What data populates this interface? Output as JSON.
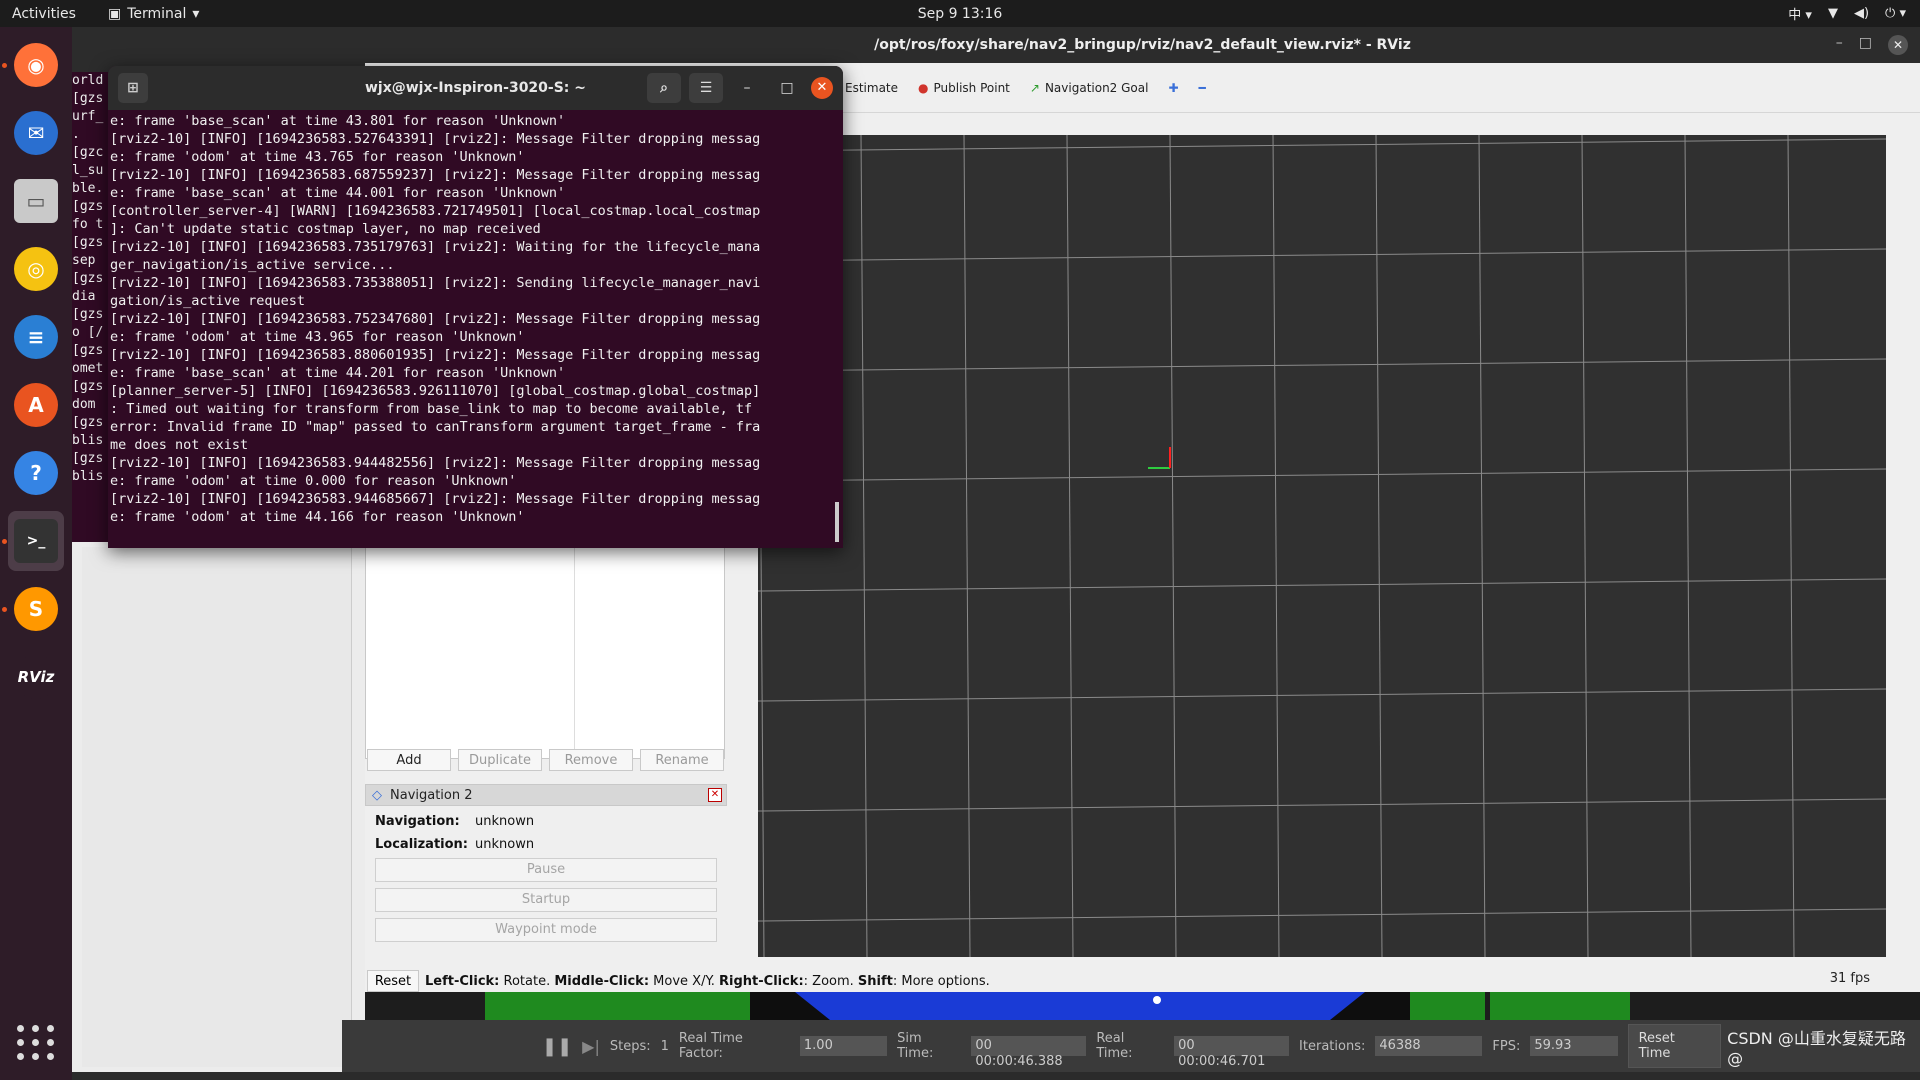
{
  "topbar": {
    "activities": "Activities",
    "app_name": "Terminal",
    "clock": "Sep 9  13:16",
    "input_method": "中"
  },
  "dock": {
    "items": [
      {
        "name": "firefox-icon",
        "color": "#ff7139"
      },
      {
        "name": "thunderbird-icon",
        "color": "#2a6fd0"
      },
      {
        "name": "files-icon",
        "color": "#c9c9c9"
      },
      {
        "name": "rhythmbox-icon",
        "color": "#f5c211"
      },
      {
        "name": "writer-icon",
        "color": "#2a7fd4"
      },
      {
        "name": "software-center-icon",
        "color": "#e95420"
      },
      {
        "name": "help-icon",
        "color": "#3584e4"
      },
      {
        "name": "terminal-icon",
        "color": "#333333"
      },
      {
        "name": "sublime-icon",
        "color": "#ff9800"
      },
      {
        "name": "rviz-icon",
        "color": "#2e1c28"
      }
    ]
  },
  "bg_terminal": {
    "lines": [
      "orld",
      "[gzs",
      "urf_",
      ".",
      "[gzc",
      "l_su",
      "ble.",
      "[gzs",
      "fo t",
      "[gzs",
      " sep",
      "[gzs",
      " dia",
      "[gzs",
      "o [/",
      "[gzs",
      "omet",
      "[gzs",
      "dom ",
      "[gzs",
      "blis",
      "[gzs",
      "blis"
    ]
  },
  "rviz": {
    "title": "/opt/ros/foxy/share/nav2_bringup/rviz/nav2_default_view.rviz* - RViz",
    "toolbar": {
      "estimate": "Estimate",
      "publish_point": "Publish Point",
      "nav2_goal": "Navigation2 Goal"
    },
    "displays_buttons": {
      "add": "Add",
      "duplicate": "Duplicate",
      "remove": "Remove",
      "rename": "Rename"
    },
    "nav_panel": {
      "title": "Navigation 2",
      "navigation_label": "Navigation:",
      "navigation_value": "unknown",
      "localization_label": "Localization:",
      "localization_value": "unknown",
      "pause": "Pause",
      "startup": "Startup",
      "waypoint": "Waypoint mode"
    },
    "status": {
      "reset": "Reset",
      "left_click": "Left-Click:",
      "left_action": " Rotate. ",
      "middle_click": "Middle-Click:",
      "middle_action": " Move X/Y. ",
      "right_click": "Right-Click:",
      "right_action": ": Zoom. ",
      "shift": "Shift",
      "shift_action": ": More options."
    },
    "fps": "31 fps"
  },
  "gazebo": {
    "steps_label": "Steps:",
    "steps_value": "1",
    "rtf_label": "Real Time Factor:",
    "rtf_value": "1.00",
    "sim_label": "Sim Time:",
    "sim_value": "00 00:00:46.388",
    "real_label": "Real Time:",
    "real_value": "00 00:00:46.701",
    "iter_label": "Iterations:",
    "iter_value": "46388",
    "fps_label": "FPS:",
    "fps_value": "59.93",
    "reset_time": "Reset Time",
    "watermark": "CSDN @山重水复疑无路@"
  },
  "terminal": {
    "title": "wjx@wjx-Inspiron-3020-S: ~",
    "body": "e: frame 'base_scan' at time 43.801 for reason 'Unknown'\n[rviz2-10] [INFO] [1694236583.527643391] [rviz2]: Message Filter dropping messag\ne: frame 'odom' at time 43.765 for reason 'Unknown'\n[rviz2-10] [INFO] [1694236583.687559237] [rviz2]: Message Filter dropping messag\ne: frame 'base_scan' at time 44.001 for reason 'Unknown'\n[controller_server-4] [WARN] [1694236583.721749501] [local_costmap.local_costmap\n]: Can't update static costmap layer, no map received\n[rviz2-10] [INFO] [1694236583.735179763] [rviz2]: Waiting for the lifecycle_mana\nger_navigation/is_active service...\n[rviz2-10] [INFO] [1694236583.735388051] [rviz2]: Sending lifecycle_manager_navi\ngation/is_active request\n[rviz2-10] [INFO] [1694236583.752347680] [rviz2]: Message Filter dropping messag\ne: frame 'odom' at time 43.965 for reason 'Unknown'\n[rviz2-10] [INFO] [1694236583.880601935] [rviz2]: Message Filter dropping messag\ne: frame 'base_scan' at time 44.201 for reason 'Unknown'\n[planner_server-5] [INFO] [1694236583.926111070] [global_costmap.global_costmap]\n: Timed out waiting for transform from base_link to map to become available, tf\nerror: Invalid frame ID \"map\" passed to canTransform argument target_frame - fra\nme does not exist\n[rviz2-10] [INFO] [1694236583.944482556] [rviz2]: Message Filter dropping messag\ne: frame 'odom' at time 0.000 for reason 'Unknown'\n[rviz2-10] [INFO] [1694236583.944685667] [rviz2]: Message Filter dropping messag\ne: frame 'odom' at time 44.166 for reason 'Unknown'"
  }
}
